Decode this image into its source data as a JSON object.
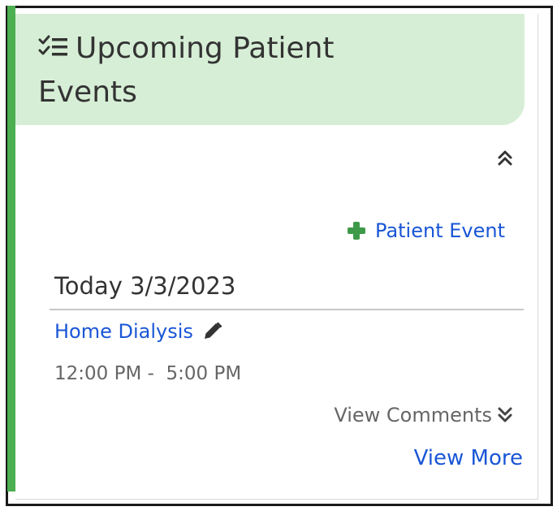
{
  "panel": {
    "title": "Upcoming Patient Events",
    "title_icon": "task-checklist-icon",
    "collapse_icon": "chevron-double-up-icon",
    "add_button_label": "Patient Event",
    "add_icon": "plus-icon"
  },
  "day": {
    "heading": "Today 3/3/2023",
    "events": [
      {
        "name": "Home Dialysis",
        "edit_icon": "pencil-icon",
        "time": "12:00 PM -  5:00 PM",
        "comments_label": "View Comments",
        "comments_icon": "chevron-double-down-icon"
      }
    ]
  },
  "footer": {
    "view_more_label": "View More"
  },
  "colors": {
    "accent": "#4caf50",
    "header_bg": "#d6eed5",
    "link": "#1a56d6",
    "plus": "#3e9a4a",
    "muted_text": "#666666"
  }
}
